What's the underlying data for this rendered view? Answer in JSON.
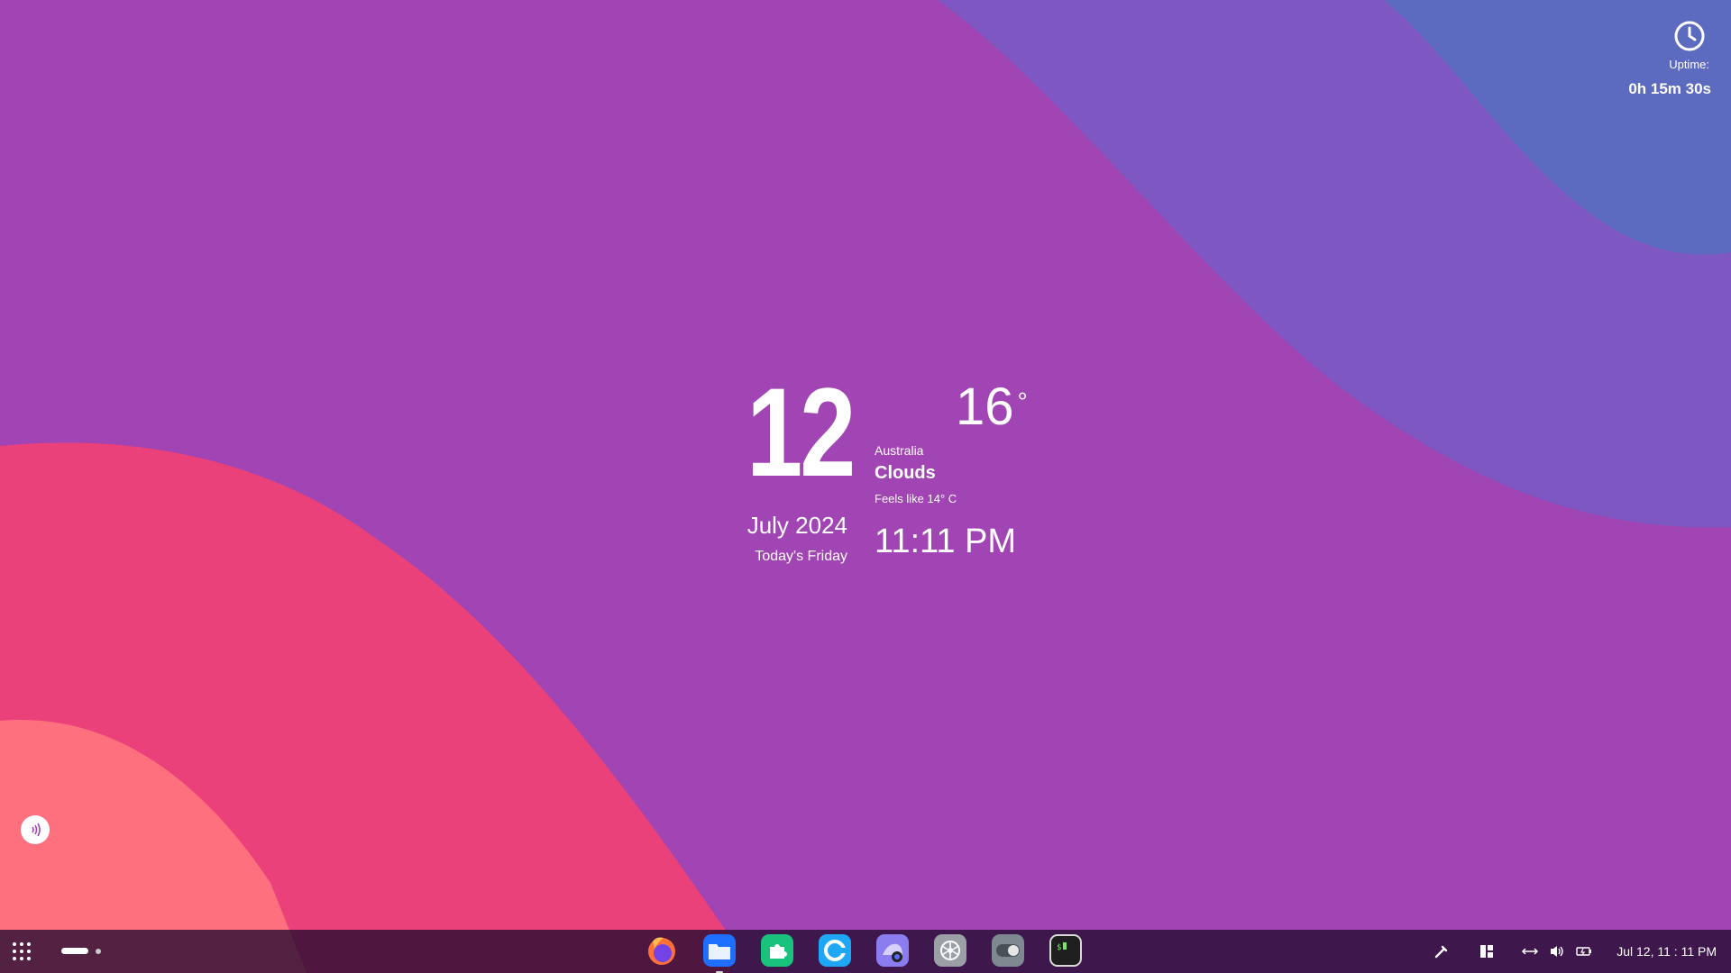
{
  "uptime": {
    "label": "Uptime:",
    "value": "0h 15m 30s",
    "icon": "clock-icon"
  },
  "date": {
    "day": "12",
    "month_year": "July 2024",
    "weekday": "Today's Friday"
  },
  "weather": {
    "temperature": "16",
    "degree_symbol": "°",
    "location": "Australia",
    "condition": "Clouds",
    "feels_like": "Feels like 14° C",
    "time": "11:11 PM"
  },
  "taskbar": {
    "dock_apps": [
      {
        "name": "firefox",
        "icon": "firefox-icon"
      },
      {
        "name": "files",
        "icon": "folder-icon",
        "running": true
      },
      {
        "name": "extensions",
        "icon": "puzzle-icon"
      },
      {
        "name": "browser",
        "icon": "c-browser-icon"
      },
      {
        "name": "screenshot",
        "icon": "camera-icon"
      },
      {
        "name": "settings",
        "icon": "gear-icon"
      },
      {
        "name": "tweaks",
        "icon": "toggle-icon"
      },
      {
        "name": "terminal",
        "icon": "terminal-icon"
      }
    ],
    "tray_icons": [
      "color-picker-icon",
      "layout-icon",
      "network-icon",
      "volume-icon",
      "battery-icon"
    ],
    "datetime": "Jul 12, 11 : 11 PM"
  },
  "colors": {
    "background": "#a144b4",
    "wave_pink": "#eb417a",
    "wave_light_pink": "#ff707f",
    "wave_violet": "#7e57c2",
    "wave_blue": "#5c6bc0",
    "taskbar": "#230c30"
  }
}
